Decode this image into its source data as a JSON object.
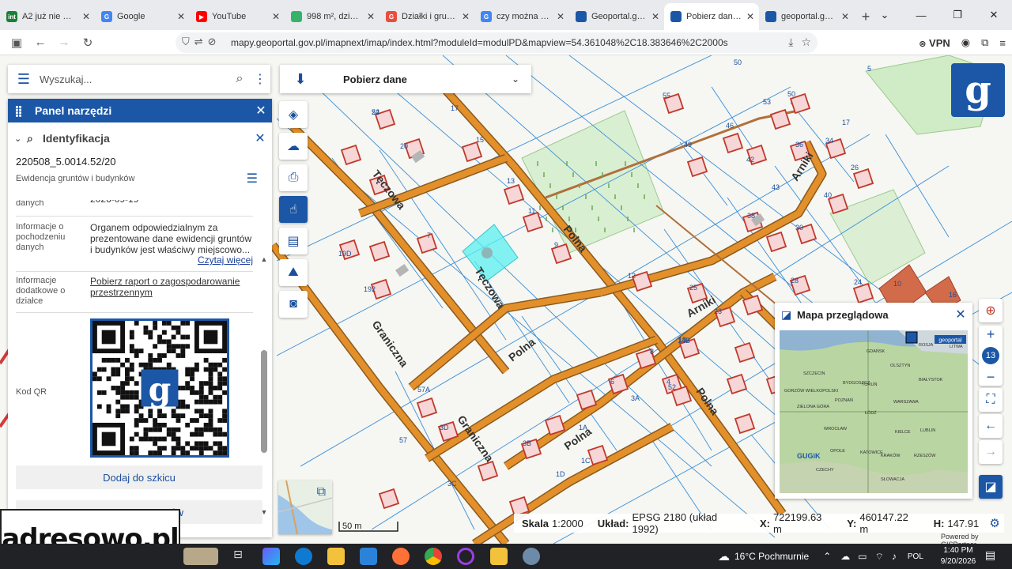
{
  "browser": {
    "tabs": [
      {
        "label": "A2 już nie ma. El",
        "fav": "int",
        "color": "#1a7f37"
      },
      {
        "label": "Google",
        "fav": "G",
        "color": "#4285f4"
      },
      {
        "label": "YouTube",
        "fav": "▶",
        "color": "#ff0000"
      },
      {
        "label": "998 m², działka",
        "fav": "",
        "color": "#35b36b"
      },
      {
        "label": "Działki i grunty",
        "fav": "G",
        "color": "#e94d3d"
      },
      {
        "label": "czy można wyko",
        "fav": "G",
        "color": "#4285f4"
      },
      {
        "label": "Geoportal.gov.pl",
        "fav": "",
        "color": "#1b57a6"
      },
      {
        "label": "Pobierz dane - C",
        "fav": "",
        "color": "#1b57a6"
      },
      {
        "label": "geoportal.gov.pl",
        "fav": "",
        "color": "#1b57a6"
      }
    ],
    "active_tab": 7,
    "url": "mapy.geoportal.gov.pl/imapnext/imap/index.html?moduleId=modulPD&mapview=54.361048%2C18.383646%2C2000s",
    "vpn": "VPN"
  },
  "search": {
    "placeholder": "Wyszukaj..."
  },
  "toolpanel": {
    "title": "Panel narzędzi",
    "section": "Identyfikacja",
    "parcel_id": "220508_5.0014.52/20",
    "registry": "Ewidencja gruntów i budynków",
    "rows": [
      {
        "label": "danych",
        "value": "2026-09-19"
      },
      {
        "label": "Informacje o pochodzeniu danych",
        "value": "Organem odpowiedzialnym za prezentowane dane ewidencji gruntów i budynków jest właściwy miejscowo...",
        "link": "Czytaj więcej"
      },
      {
        "label": "Informacje dodatkowe o działce",
        "link": "Pobierz raport o zagospodarowanie przestrzennym"
      },
      {
        "label": "Kod QR"
      }
    ],
    "btn_sketch": "Dodaj do szkicu",
    "btn_second": "ów"
  },
  "download": {
    "label": "Pobierz dane"
  },
  "overview": {
    "title": "Mapa przeglądowa",
    "cities": [
      "GDAŃSK",
      "OLSZTYN",
      "SZCZECIN",
      "BYDGOSZCZ",
      "TORUŃ",
      "BIAŁYSTOK",
      "GORZÓW WIELKOPOLSKI",
      "POZNAŃ",
      "WARSZAWA",
      "ZIELONA GÓRA",
      "ŁÓDŹ",
      "WROCŁAW",
      "OPOLE",
      "KIELCE",
      "LUBLIN",
      "KATOWICE",
      "KRAKÓW",
      "RZESZÓW",
      "ROSJA",
      "LITWA",
      "CZECHY",
      "SŁOWACJA"
    ],
    "brand": "geoportal",
    "brand2": "GUGiK"
  },
  "zoom": {
    "level": "13"
  },
  "status": {
    "scale_label": "Skala",
    "scale_value": "1:2000",
    "crs_label": "Układ:",
    "crs_value": "EPSG 2180 (układ 1992)",
    "x_label": "X:",
    "x_value": "722199.63 m",
    "y_label": "Y:",
    "y_value": "460147.22 m",
    "h_label": "H:",
    "h_value": "147.91",
    "powered": "Powered by GISPartner"
  },
  "scalebar": {
    "label": "50 m"
  },
  "map": {
    "streets": [
      "Tęczowa",
      "Tęczowa",
      "Polna",
      "Polna",
      "Polna",
      "Polna",
      "Graniczna",
      "Graniczna",
      "Arniki",
      "Arniki"
    ],
    "numbers": [
      "22",
      "20",
      "15",
      "17",
      "13",
      "11",
      "9",
      "7",
      "19D",
      "192",
      "12",
      "25",
      "23",
      "19",
      "17",
      "14B",
      "8",
      "6",
      "4",
      "3A",
      "1A",
      "1C",
      "1D",
      "3B",
      "3C",
      "3D",
      "57A",
      "57",
      "55",
      "53",
      "50",
      "46",
      "49",
      "36",
      "34",
      "42",
      "43",
      "38",
      "40",
      "30",
      "26",
      "28",
      "24",
      "16",
      "10",
      "5",
      "52",
      "50",
      "54"
    ]
  },
  "watermark": "adresowo.pl",
  "taskbar": {
    "weather": "16°C Pochmurnie",
    "lang": "POL",
    "time": "1:40 PM",
    "date": "9/20/2026"
  },
  "colors": {
    "accent": "#1b57a6",
    "road": "#e3902b",
    "building": "#c0392b",
    "parcel": "#3a8fd6",
    "selected": "#59f0f0"
  }
}
